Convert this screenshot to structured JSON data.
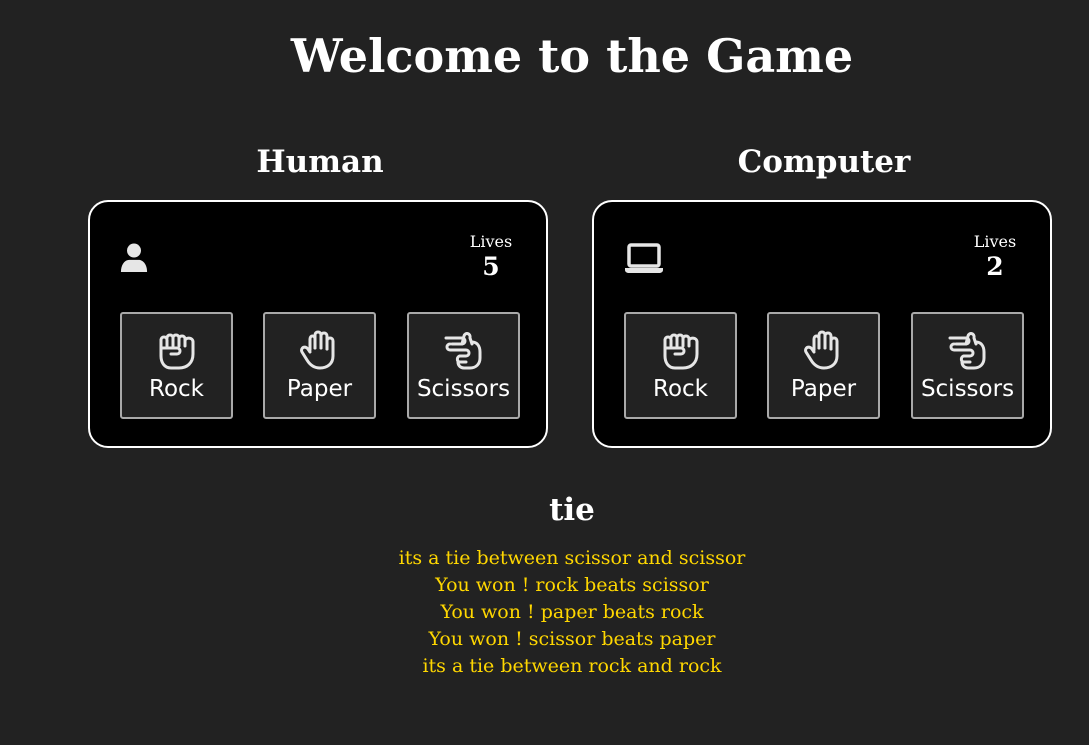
{
  "title": "Welcome to the Game",
  "human": {
    "heading": "Human",
    "icon": "user-icon",
    "lives_label": "Lives",
    "lives": "5",
    "choices": [
      {
        "label": "Rock",
        "icon": "fist-icon"
      },
      {
        "label": "Paper",
        "icon": "open-hand-icon"
      },
      {
        "label": "Scissors",
        "icon": "scissors-hand-icon"
      }
    ]
  },
  "computer": {
    "heading": "Computer",
    "icon": "laptop-icon",
    "lives_label": "Lives",
    "lives": "2",
    "choices": [
      {
        "label": "Rock",
        "icon": "fist-icon"
      },
      {
        "label": "Paper",
        "icon": "open-hand-icon"
      },
      {
        "label": "Scissors",
        "icon": "scissors-hand-icon"
      }
    ]
  },
  "result": "tie",
  "history": [
    "its a tie between scissor and scissor",
    "You won ! rock beats scissor",
    "You won ! paper beats rock",
    "You won ! scissor beats paper",
    "its a tie between rock and rock"
  ],
  "colors": {
    "background": "#222222",
    "panel": "#000000",
    "history_text": "#ffd700"
  }
}
